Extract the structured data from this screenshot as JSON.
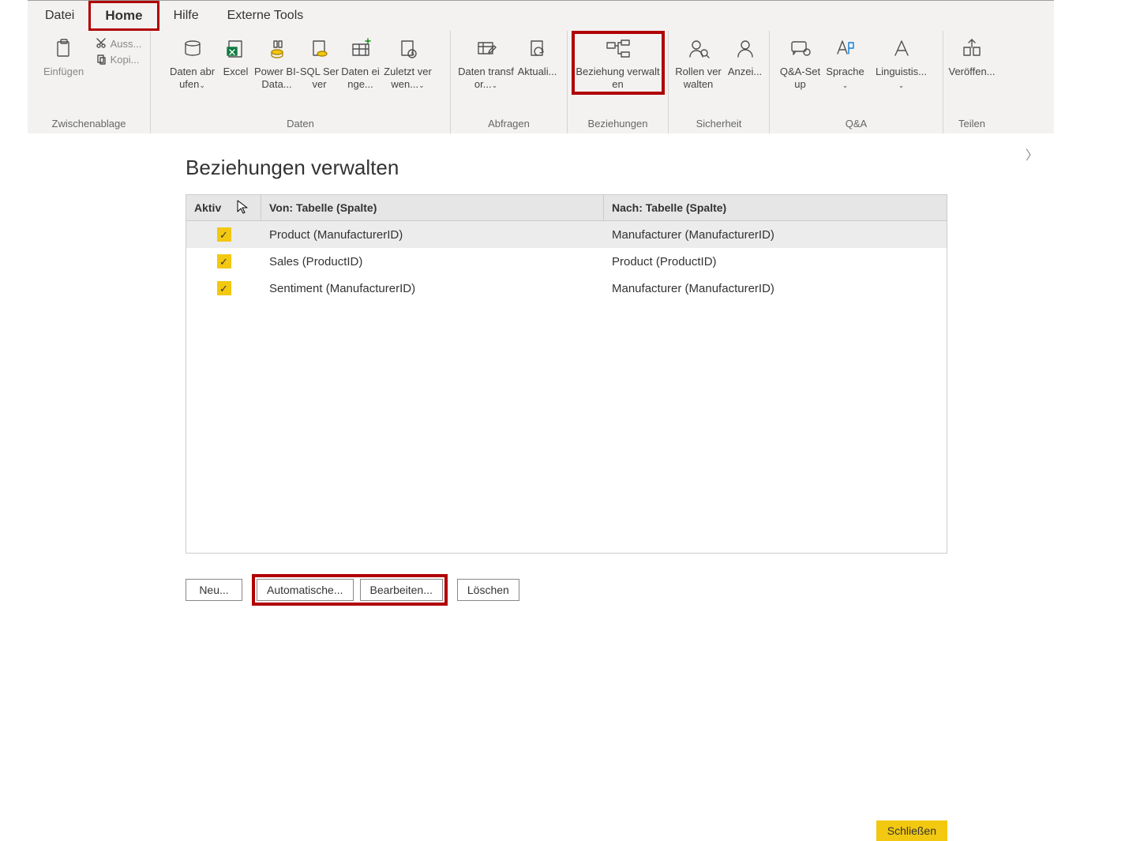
{
  "tabs": {
    "datei": "Datei",
    "home": "Home",
    "hilfe": "Hilfe",
    "externe": "Externe Tools"
  },
  "clipboard": {
    "einfuegen": "Einfügen",
    "ausschneiden": "Auss...",
    "kopieren": "Kopi...",
    "group": "Zwischenablage"
  },
  "daten": {
    "abrufen": "Daten abrufen",
    "excel": "Excel",
    "powerbi": "Power BI-Data...",
    "sql": "SQL Server",
    "eingeben": "Daten einge...",
    "zuletzt": "Zuletzt verwen...",
    "group": "Daten"
  },
  "abfragen": {
    "transform": "Daten transfor...",
    "aktual": "Aktuali...",
    "group": "Abfragen"
  },
  "bez": {
    "verwalten": "Beziehung verwalten",
    "group": "Beziehungen"
  },
  "sich": {
    "rollen": "Rollen verwalten",
    "anzeigen": "Anzei...",
    "group": "Sicherheit"
  },
  "qa": {
    "setup": "Q&A-Setup",
    "sprache": "Sprache",
    "ling": "Linguistis...",
    "group": "Q&A"
  },
  "teilen": {
    "veroeff": "Veröffen...",
    "group": "Teilen"
  },
  "dialog": {
    "title": "Beziehungen verwalten",
    "headers": {
      "aktiv": "Aktiv",
      "von": "Von: Tabelle (Spalte)",
      "nach": "Nach: Tabelle (Spalte)"
    },
    "rows": [
      {
        "active": true,
        "von": "Product (ManufacturerID)",
        "nach": "Manufacturer (ManufacturerID)",
        "selected": true
      },
      {
        "active": true,
        "von": "Sales (ProductID)",
        "nach": "Product (ProductID)",
        "selected": false
      },
      {
        "active": true,
        "von": "Sentiment (ManufacturerID)",
        "nach": "Manufacturer (ManufacturerID)",
        "selected": false
      }
    ],
    "buttons": {
      "neu": "Neu...",
      "auto": "Automatische...",
      "bearbeiten": "Bearbeiten...",
      "loeschen": "Löschen",
      "schliessen": "Schließen"
    }
  }
}
